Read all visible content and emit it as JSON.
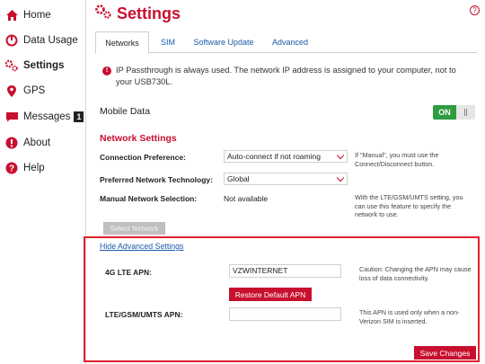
{
  "sidebar": {
    "items": [
      {
        "label": "Home",
        "icon": "home-icon"
      },
      {
        "label": "Data Usage",
        "icon": "data-usage-icon"
      },
      {
        "label": "Settings",
        "icon": "settings-icon",
        "active": true
      },
      {
        "label": "GPS",
        "icon": "location-pin-icon"
      },
      {
        "label": "Messages",
        "icon": "message-icon",
        "badge": "1"
      },
      {
        "label": "About",
        "icon": "info-icon"
      },
      {
        "label": "Help",
        "icon": "help-icon"
      }
    ]
  },
  "header": {
    "title": "Settings",
    "help_glyph": "?"
  },
  "tabs": [
    {
      "label": "Networks",
      "active": true
    },
    {
      "label": "SIM"
    },
    {
      "label": "Software Update"
    },
    {
      "label": "Advanced"
    }
  ],
  "notice": {
    "icon_glyph": "!",
    "text": "IP Passthrough is always used. The network IP address is assigned to your computer, not to your USB730L."
  },
  "mobile_data": {
    "label": "Mobile Data",
    "toggle_label": "ON",
    "enabled": true
  },
  "network_settings": {
    "title": "Network Settings",
    "connection_preference": {
      "label": "Connection Preference:",
      "value": "Auto-connect if not roaming",
      "hint": "If \"Manual\", you must use the Connect/Disconnect button."
    },
    "preferred_technology": {
      "label": "Preferred Network Technology:",
      "value": "Global"
    },
    "manual_selection": {
      "label": "Manual Network Selection:",
      "value": "Not available",
      "hint": "With the LTE/GSM/UMTS setting, you can use this feature to specify the network to use."
    },
    "select_network_button": "Select Network"
  },
  "advanced": {
    "hide_link": "Hide Advanced Settings",
    "lte_apn": {
      "label": "4G LTE APN:",
      "value": "VZWINTERNET",
      "hint": "Caution: Changing the APN may cause loss of data connectivity."
    },
    "restore_button": "Restore Default APN",
    "gsm_apn": {
      "label": "LTE/GSM/UMTS APN:",
      "value": "",
      "hint": "This APN is used only when a non-Verizon SIM is inserted."
    },
    "save_button": "Save Changes"
  },
  "colors": {
    "accent": "#c8102e",
    "link": "#1a5aa6",
    "toggle_on": "#2e9c3f",
    "highlight_border": "#e2202c"
  }
}
